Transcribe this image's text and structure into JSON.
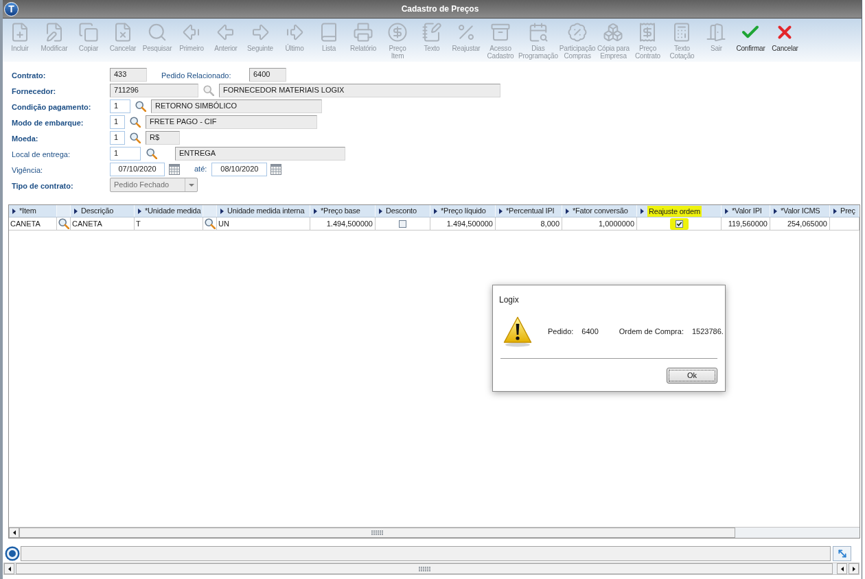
{
  "window": {
    "logo": "T",
    "title": "Cadastro de Preços"
  },
  "toolbar": [
    {
      "label": "Incluir",
      "disabled": true
    },
    {
      "label": "Modificar",
      "disabled": true
    },
    {
      "label": "Copiar",
      "disabled": true
    },
    {
      "label": "Cancelar",
      "disabled": true
    },
    {
      "label": "Pesquisar",
      "disabled": true
    },
    {
      "label": "Primeiro",
      "disabled": true
    },
    {
      "label": "Anterior",
      "disabled": true
    },
    {
      "label": "Seguinte",
      "disabled": true
    },
    {
      "label": "Último",
      "disabled": true
    },
    {
      "label": "Lista",
      "disabled": true
    },
    {
      "label": "Relatório",
      "disabled": true
    },
    {
      "label": "Preço\nItem",
      "disabled": true
    },
    {
      "label": "Texto",
      "disabled": true
    },
    {
      "label": "Reajustar",
      "disabled": true
    },
    {
      "label": "Acesso\nCadastro",
      "disabled": true
    },
    {
      "label": "Dias\nProgramação",
      "disabled": true
    },
    {
      "label": "Participação\nCompras",
      "disabled": true
    },
    {
      "label": "Cópia para\nEmpresa",
      "disabled": true
    },
    {
      "label": "Preço\nContrato",
      "disabled": true
    },
    {
      "label": "Texto\nCotação",
      "disabled": true
    },
    {
      "label": "Sair",
      "disabled": true
    },
    {
      "label": "Confirmar",
      "disabled": false
    },
    {
      "label": "Cancelar",
      "disabled": false
    }
  ],
  "form": {
    "contrato": {
      "label": "Contrato:",
      "required": true,
      "value": "433",
      "readonly": true
    },
    "pedido_relacionado": {
      "label": "Pedido Relacionado:",
      "required": false,
      "value": "6400",
      "readonly": true
    },
    "fornecedor": {
      "label": "Fornecedor:",
      "required": true,
      "code": "711296",
      "readonly": true,
      "description": "FORNECEDOR MATERIAIS LOGIX"
    },
    "condicao_pagamento": {
      "label": "Condição pagamento:",
      "required": true,
      "code": "1",
      "readonly": false,
      "description": "RETORNO SIMBÓLICO"
    },
    "modo_embarque": {
      "label": "Modo de embarque:",
      "required": true,
      "code": "1",
      "readonly": false,
      "description": "FRETE PAGO - CIF"
    },
    "moeda": {
      "label": "Moeda:",
      "required": true,
      "code": "1",
      "readonly": false,
      "description": "R$"
    },
    "local_entrega": {
      "label": "Local de entrega:",
      "required": false,
      "code": "1",
      "readonly": false,
      "description": "ENTREGA"
    },
    "vigencia": {
      "label": "Vigência:",
      "required": false,
      "start": "07/10/2020",
      "end_label": "até:",
      "end": "08/10/2020"
    },
    "tipo_contrato": {
      "label": "Tipo de contrato:",
      "required": true,
      "value": "Pedido Fechado",
      "disabled": true
    }
  },
  "table": {
    "columns": [
      {
        "kind": "field",
        "label": "*Item",
        "highlighted": false
      },
      {
        "kind": "lookup",
        "highlighted": false
      },
      {
        "kind": "field",
        "label": "Descrição",
        "highlighted": false
      },
      {
        "kind": "field",
        "label": "*Unidade medida",
        "highlighted": false
      },
      {
        "kind": "lookup",
        "highlighted": false
      },
      {
        "kind": "field",
        "label": "Unidade medida interna",
        "highlighted": false
      },
      {
        "kind": "field",
        "label": "*Preço base",
        "highlighted": false
      },
      {
        "kind": "field",
        "label": "Desconto",
        "highlighted": false
      },
      {
        "kind": "field",
        "label": "*Preço líquido",
        "highlighted": false
      },
      {
        "kind": "field",
        "label": "*Percentual IPI",
        "highlighted": false
      },
      {
        "kind": "field",
        "label": "*Fator conversão",
        "highlighted": false
      },
      {
        "kind": "field",
        "label": "Reajuste ordem",
        "highlighted": true
      },
      {
        "kind": "field",
        "label": "*Valor IPI",
        "highlighted": false
      },
      {
        "kind": "field",
        "label": "*Valor ICMS",
        "highlighted": false
      },
      {
        "kind": "field",
        "label": "Preç",
        "highlighted": false
      }
    ],
    "rows": [
      {
        "cells": [
          {
            "kind": "text",
            "text": "CANETA"
          },
          {
            "kind": "lookup"
          },
          {
            "kind": "text",
            "text": "CANETA"
          },
          {
            "kind": "text",
            "text": "T"
          },
          {
            "kind": "lookup"
          },
          {
            "kind": "text",
            "text": "UN"
          },
          {
            "kind": "number",
            "text": "1.494,500000"
          },
          {
            "kind": "check",
            "checked": false
          },
          {
            "kind": "number",
            "text": "1.494,500000"
          },
          {
            "kind": "number",
            "text": "8,000"
          },
          {
            "kind": "number",
            "text": "1,0000000"
          },
          {
            "kind": "check",
            "checked": true
          },
          {
            "kind": "number",
            "text": "119,560000"
          },
          {
            "kind": "number",
            "text": "254,065000"
          }
        ]
      }
    ]
  },
  "dialog": {
    "title": "Logix",
    "fields": [
      {
        "label": "Pedido:",
        "value": "6400"
      },
      {
        "label": "Ordem de Compra:",
        "value": "1523786."
      }
    ],
    "button": {
      "label": "Ok",
      "focused": true
    }
  }
}
